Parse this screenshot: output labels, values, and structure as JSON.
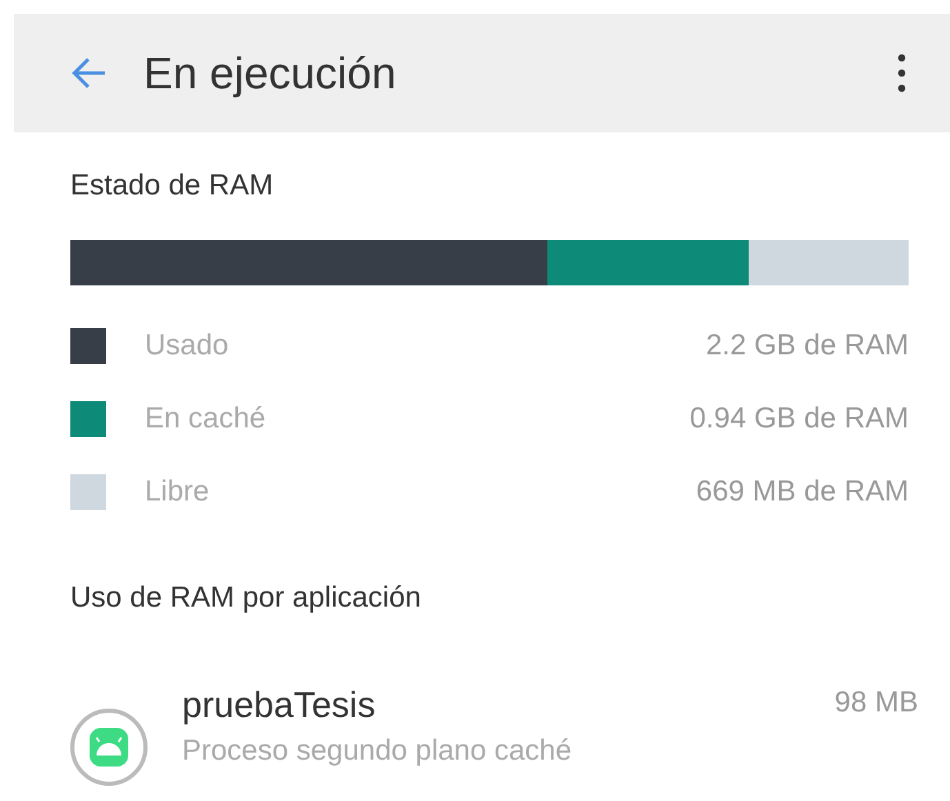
{
  "header": {
    "title": "En ejecución"
  },
  "ram_status": {
    "title": "Estado de RAM",
    "items": [
      {
        "label": "Usado",
        "value": "2.2 GB de RAM",
        "color": "#373e47"
      },
      {
        "label": "En caché",
        "value": "0.94 GB de RAM",
        "color": "#0d8a78"
      },
      {
        "label": "Libre",
        "value": "669 MB de RAM",
        "color": "#d0d8df"
      }
    ]
  },
  "apps_section": {
    "title": "Uso de RAM por aplicación",
    "apps": [
      {
        "name": "pruebaTesis",
        "description": "Proceso segundo plano caché",
        "size": "98 MB"
      }
    ]
  }
}
